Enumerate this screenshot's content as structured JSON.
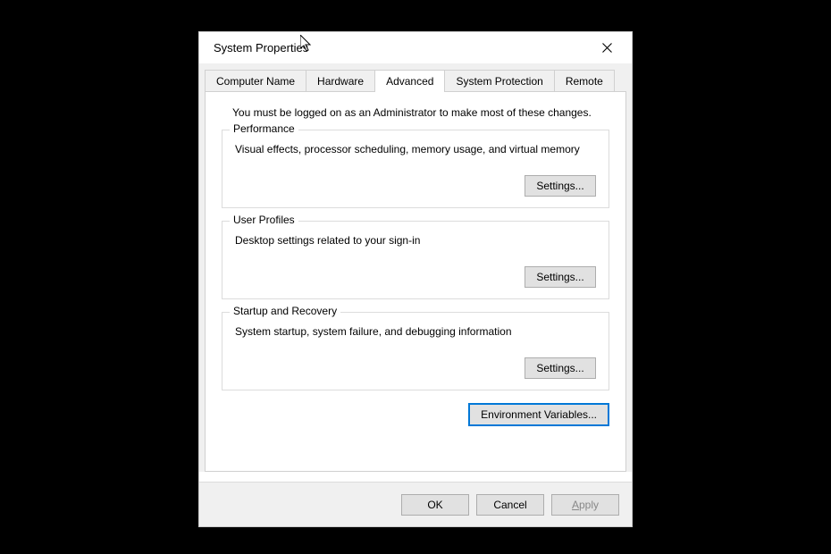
{
  "title": "System Properties",
  "tabs": [
    {
      "label": "Computer Name"
    },
    {
      "label": "Hardware"
    },
    {
      "label": "Advanced"
    },
    {
      "label": "System Protection"
    },
    {
      "label": "Remote"
    }
  ],
  "admin_note": "You must be logged on as an Administrator to make most of these changes.",
  "groups": {
    "performance": {
      "legend": "Performance",
      "desc": "Visual effects, processor scheduling, memory usage, and virtual memory",
      "button": "Settings..."
    },
    "user_profiles": {
      "legend": "User Profiles",
      "desc": "Desktop settings related to your sign-in",
      "button": "Settings..."
    },
    "startup": {
      "legend": "Startup and Recovery",
      "desc": "System startup, system failure, and debugging information",
      "button": "Settings..."
    }
  },
  "env_button": "Environment Variables...",
  "footer": {
    "ok": "OK",
    "cancel": "Cancel",
    "apply_prefix": "A",
    "apply_rest": "pply"
  }
}
